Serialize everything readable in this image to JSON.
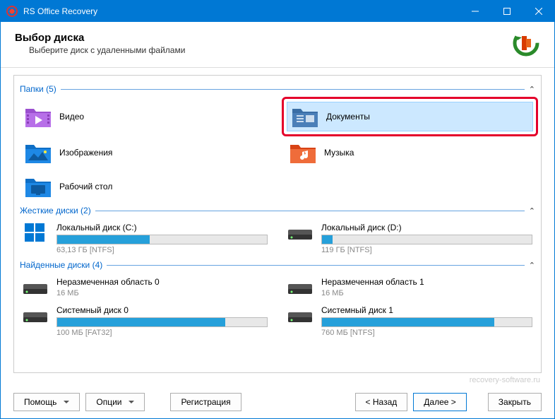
{
  "titlebar": {
    "title": "RS Office Recovery"
  },
  "header": {
    "title": "Выбор диска",
    "subtitle": "Выберите диск с удаленными файлами"
  },
  "groups": {
    "folders": {
      "title": "Папки (5)"
    },
    "hard": {
      "title": "Жесткие диски (2)"
    },
    "found": {
      "title": "Найденные диски (4)"
    }
  },
  "folders": [
    {
      "label": "Видео"
    },
    {
      "label": "Документы"
    },
    {
      "label": "Изображения"
    },
    {
      "label": "Музыка"
    },
    {
      "label": "Рабочий стол"
    }
  ],
  "hard_disks": [
    {
      "name": "Локальный диск (C:)",
      "meta": "63,13 ГБ [NTFS]",
      "fill": 44
    },
    {
      "name": "Локальный диск (D:)",
      "meta": "119 ГБ [NTFS]",
      "fill": 5
    }
  ],
  "found_disks": [
    {
      "name": "Неразмеченная область 0",
      "meta": "16 МБ",
      "fill": 0
    },
    {
      "name": "Неразмеченная область 1",
      "meta": "16 МБ",
      "fill": 0
    },
    {
      "name": "Системный диск 0",
      "meta": "100 МБ [FAT32]",
      "fill": 80
    },
    {
      "name": "Системный диск 1",
      "meta": "760 МБ [NTFS]",
      "fill": 82
    }
  ],
  "footer": {
    "help": "Помощь",
    "options": "Опции",
    "register": "Регистрация",
    "back": "< Назад",
    "next": "Далее >",
    "close": "Закрыть",
    "branding": "recovery-software.ru"
  }
}
